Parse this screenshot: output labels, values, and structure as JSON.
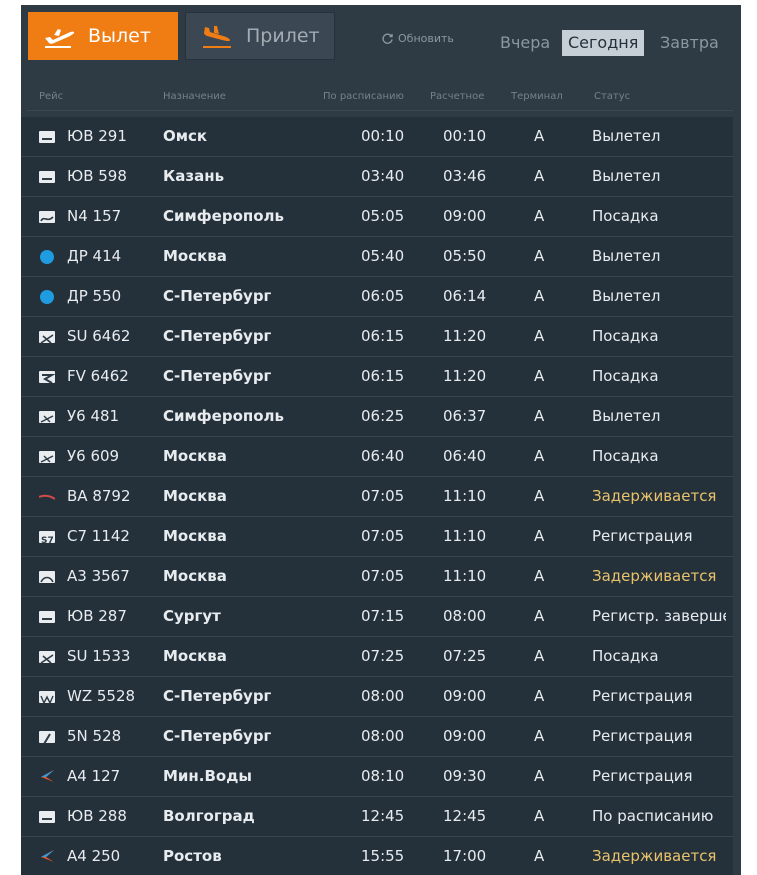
{
  "tabs": {
    "departure_label": "Вылет",
    "arrival_label": "Прилет"
  },
  "toolbar": {
    "refresh_label": "Обновить",
    "yesterday": "Вчера",
    "today": "Сегодня",
    "tomorrow": "Завтра"
  },
  "colors": {
    "accent": "#f07c14",
    "delay": "#e9c36a",
    "board_bg": "#2e3a44",
    "row_bg": "#24303a"
  },
  "columns": {
    "flight": "Рейс",
    "destination": "Назначение",
    "scheduled": "По расписанию",
    "estimated": "Расчетное",
    "terminal": "Терминал",
    "status": "Статус"
  },
  "flights": [
    {
      "logo": "utair-logo-icon",
      "flight": "ЮВ 291",
      "destination": "Омск",
      "scheduled": "00:10",
      "estimated": "00:10",
      "terminal": "A",
      "status": "Вылетел",
      "delayed": false
    },
    {
      "logo": "utair-logo-icon",
      "flight": "ЮВ 598",
      "destination": "Казань",
      "scheduled": "03:40",
      "estimated": "03:46",
      "terminal": "A",
      "status": "Вылетел",
      "delayed": false
    },
    {
      "logo": "nordwind-logo-icon",
      "flight": "N4 157",
      "destination": "Симферополь",
      "scheduled": "05:05",
      "estimated": "09:00",
      "terminal": "A",
      "status": "Посадка",
      "delayed": false
    },
    {
      "logo": "rusline-logo-icon",
      "flight": "ДР 414",
      "destination": "Москва",
      "scheduled": "05:40",
      "estimated": "05:50",
      "terminal": "A",
      "status": "Вылетел",
      "delayed": false
    },
    {
      "logo": "rusline-logo-icon",
      "flight": "ДР 550",
      "destination": "С-Петербург",
      "scheduled": "06:05",
      "estimated": "06:14",
      "terminal": "A",
      "status": "Вылетел",
      "delayed": false
    },
    {
      "logo": "aeroflot-logo-icon",
      "flight": "SU 6462",
      "destination": "С-Петербург",
      "scheduled": "06:15",
      "estimated": "11:20",
      "terminal": "A",
      "status": "Посадка",
      "delayed": false
    },
    {
      "logo": "rossiya-logo-icon",
      "flight": "FV 6462",
      "destination": "С-Петербург",
      "scheduled": "06:15",
      "estimated": "11:20",
      "terminal": "A",
      "status": "Посадка",
      "delayed": false
    },
    {
      "logo": "ural-logo-icon",
      "flight": "У6 481",
      "destination": "Симферополь",
      "scheduled": "06:25",
      "estimated": "06:37",
      "terminal": "A",
      "status": "Вылетел",
      "delayed": false
    },
    {
      "logo": "ural-logo-icon",
      "flight": "У6 609",
      "destination": "Москва",
      "scheduled": "06:40",
      "estimated": "06:40",
      "terminal": "A",
      "status": "Посадка",
      "delayed": false
    },
    {
      "logo": "nordstar-logo-icon",
      "flight": "ВА 8792",
      "destination": "Москва",
      "scheduled": "07:05",
      "estimated": "11:10",
      "terminal": "A",
      "status": "Задерживается",
      "delayed": true
    },
    {
      "logo": "s7-logo-icon",
      "flight": "С7 1142",
      "destination": "Москва",
      "scheduled": "07:05",
      "estimated": "11:10",
      "terminal": "A",
      "status": "Регистрация",
      "delayed": false
    },
    {
      "logo": "azimuth-logo-icon",
      "flight": "А3 3567",
      "destination": "Москва",
      "scheduled": "07:05",
      "estimated": "11:10",
      "terminal": "A",
      "status": "Задерживается",
      "delayed": true
    },
    {
      "logo": "utair-logo-icon",
      "flight": "ЮВ 287",
      "destination": "Сургут",
      "scheduled": "07:15",
      "estimated": "08:00",
      "terminal": "A",
      "status": "Регистр. завершена",
      "delayed": false
    },
    {
      "logo": "aeroflot-logo-icon",
      "flight": "SU 1533",
      "destination": "Москва",
      "scheduled": "07:25",
      "estimated": "07:25",
      "terminal": "A",
      "status": "Посадка",
      "delayed": false
    },
    {
      "logo": "wizzair-logo-icon",
      "flight": "WZ 5528",
      "destination": "С-Петербург",
      "scheduled": "08:00",
      "estimated": "09:00",
      "terminal": "A",
      "status": "Регистрация",
      "delayed": false
    },
    {
      "logo": "nordavia-logo-icon",
      "flight": "5N 528",
      "destination": "С-Петербург",
      "scheduled": "08:00",
      "estimated": "09:00",
      "terminal": "A",
      "status": "Регистрация",
      "delayed": false
    },
    {
      "logo": "azimuth-wing-logo-icon",
      "flight": "А4 127",
      "destination": "Мин.Воды",
      "scheduled": "08:10",
      "estimated": "09:30",
      "terminal": "A",
      "status": "Регистрация",
      "delayed": false
    },
    {
      "logo": "utair-logo-icon",
      "flight": "ЮВ 288",
      "destination": "Волгоград",
      "scheduled": "12:45",
      "estimated": "12:45",
      "terminal": "A",
      "status": "По расписанию",
      "delayed": false
    },
    {
      "logo": "azimuth-wing-logo-icon",
      "flight": "А4 250",
      "destination": "Ростов",
      "scheduled": "15:55",
      "estimated": "17:00",
      "terminal": "A",
      "status": "Задерживается",
      "delayed": true
    }
  ]
}
